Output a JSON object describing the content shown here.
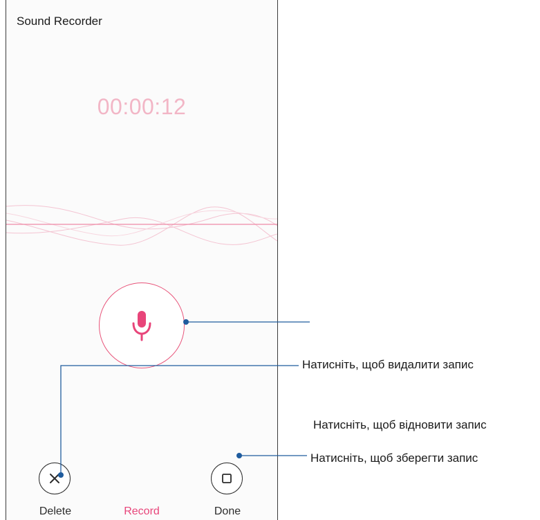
{
  "app": {
    "title": "Sound Recorder"
  },
  "recording": {
    "timer": "00:00:12"
  },
  "controls": {
    "delete_label": "Delete",
    "record_label": "Record",
    "done_label": "Done"
  },
  "callouts": {
    "delete": "Натисніть, щоб видалити запис",
    "record": "Натисніть, щоб відновити запис",
    "done": "Натисніть, щоб зберегти запис"
  },
  "colors": {
    "accent": "#e8457a",
    "timer": "#f2b6c6",
    "callout_line": "#1f5c9e"
  },
  "icons": {
    "delete": "close-icon",
    "record": "microphone-icon",
    "done": "stop-square-icon"
  }
}
